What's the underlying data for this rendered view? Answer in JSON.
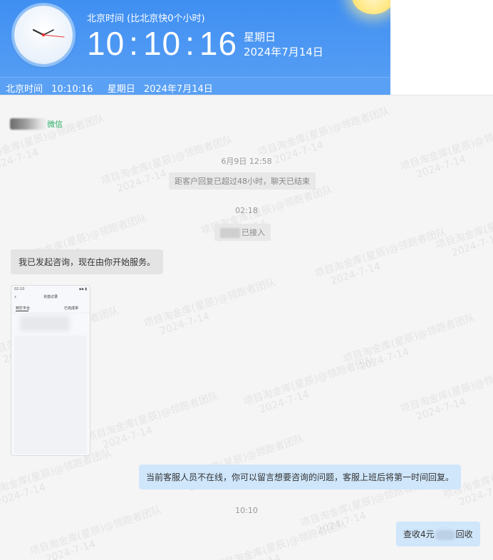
{
  "banner": {
    "timezone_label": "北京时间 (比北京快0个小时)",
    "hh": "10",
    "mm": "10",
    "ss": "16",
    "weekday": "星期日",
    "date": "2024年7月14日",
    "bar": {
      "tz": "北京时间",
      "time": "10:10:16",
      "weekday": "星期日",
      "date": "2024年7月14日"
    },
    "icons": [
      "clock-icon",
      "sun-icon"
    ]
  },
  "chat": {
    "contact_suffix": "微信",
    "stamp1": "6月9日 12:58",
    "system_ended": "距客户回复已超过48小时，聊天已结束",
    "stamp2": "02:18",
    "system_joined": "已接入",
    "msg_left": "我已发起咨询，现在由你开始服务。",
    "screenshot": {
      "status_time": "02:10",
      "title": "充值记录",
      "tab1": "到打平台",
      "tab2": "已完成单"
    },
    "msg_offline": "当前客服人员不在线，你可以留言想要咨询的问题，客服上班后将第一时间回复。",
    "stamp3": "10:10",
    "msg_last_prefix": "查收4元",
    "msg_last_suffix": "回收"
  },
  "watermark": {
    "line1": "项目淘金库(星辰)@领跑者团队",
    "line2": "2024-7-14"
  },
  "colors": {
    "banner": "#4a95f3",
    "bubble_right": "#cfe6fb",
    "bubble_left": "#e4e4e4",
    "wechat_green": "#2aae67"
  }
}
